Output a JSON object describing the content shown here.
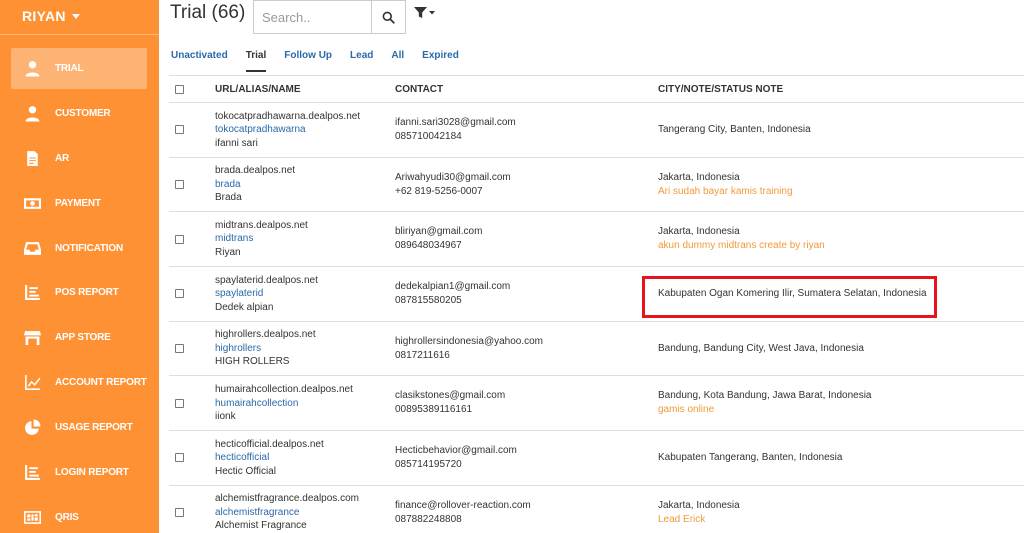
{
  "sidebar": {
    "username": "RIYAN",
    "items": [
      {
        "label": "TRIAL",
        "icon": "user-icon",
        "active": true
      },
      {
        "label": "CUSTOMER",
        "icon": "user-icon",
        "active": false
      },
      {
        "label": "AR",
        "icon": "document-icon",
        "active": false
      },
      {
        "label": "PAYMENT",
        "icon": "money-icon",
        "active": false
      },
      {
        "label": "NOTIFICATION",
        "icon": "inbox-icon",
        "active": false
      },
      {
        "label": "POS REPORT",
        "icon": "list-chart-icon",
        "active": false
      },
      {
        "label": "APP STORE",
        "icon": "store-icon",
        "active": false
      },
      {
        "label": "ACCOUNT REPORT",
        "icon": "line-chart-icon",
        "active": false
      },
      {
        "label": "USAGE REPORT",
        "icon": "pie-chart-icon",
        "active": false
      },
      {
        "label": "LOGIN REPORT",
        "icon": "list-chart-icon",
        "active": false
      },
      {
        "label": "QRIS",
        "icon": "qris-icon",
        "active": false
      }
    ]
  },
  "header": {
    "title": "Trial (66)",
    "search_placeholder": "Search.."
  },
  "tabs": [
    {
      "label": "Unactivated",
      "active": false
    },
    {
      "label": "Trial",
      "active": true
    },
    {
      "label": "Follow Up",
      "active": false
    },
    {
      "label": "Lead",
      "active": false
    },
    {
      "label": "All",
      "active": false
    },
    {
      "label": "Expired",
      "active": false
    }
  ],
  "table": {
    "columns": [
      "URL/ALIAS/NAME",
      "CONTACT",
      "CITY/NOTE/STATUS NOTE"
    ],
    "rows": [
      {
        "url": "tokocatpradhawarna.dealpos.net",
        "alias": "tokocatpradhawarna",
        "name": "ifanni sari",
        "email": "ifanni.sari3028@gmail.com",
        "phone": "085710042184",
        "city": "Tangerang City, Banten, Indonesia",
        "note": ""
      },
      {
        "url": "brada.dealpos.net",
        "alias": "brada",
        "name": "Brada",
        "email": "Ariwahyudi30@gmail.com",
        "phone": "+62 819-5256-0007",
        "city": "Jakarta, Indonesia",
        "note": "Ari sudah bayar kamis training"
      },
      {
        "url": "midtrans.dealpos.net",
        "alias": "midtrans",
        "name": "Riyan",
        "email": "bliriyan@gmail.com",
        "phone": "089648034967",
        "city": "Jakarta, Indonesia",
        "note": "akun dummy midtrans create by riyan"
      },
      {
        "url": "spaylaterid.dealpos.net",
        "alias": "spaylaterid",
        "name": "Dedek alpian",
        "email": "dedekalpian1@gmail.com",
        "phone": "087815580205",
        "city": "Kabupaten Ogan Komering Ilir, Sumatera Selatan, Indonesia",
        "note": "",
        "highlighted": true
      },
      {
        "url": "highrollers.dealpos.net",
        "alias": "highrollers",
        "name": "HIGH ROLLERS",
        "email": "highrollersindonesia@yahoo.com",
        "phone": "0817211616",
        "city": "Bandung, Bandung City, West Java, Indonesia",
        "note": ""
      },
      {
        "url": "humairahcollection.dealpos.net",
        "alias": "humairahcollection",
        "name": "iionk",
        "email": "clasikstones@gmail.com",
        "phone": "00895389116161",
        "city": "Bandung, Kota Bandung, Jawa Barat, Indonesia",
        "note": "gamis online"
      },
      {
        "url": "hecticofficial.dealpos.net",
        "alias": "hecticofficial",
        "name": "Hectic Official",
        "email": "Hecticbehavior@gmail.com",
        "phone": "085714195720",
        "city": "Kabupaten Tangerang, Banten, Indonesia",
        "note": ""
      },
      {
        "url": "alchemistfragrance.dealpos.com",
        "alias": "alchemistfragrance",
        "name": "Alchemist Fragrance",
        "email": "finance@rollover-reaction.com",
        "phone": "087882248808",
        "city": "Jakarta, Indonesia",
        "note": "Lead Erick"
      }
    ]
  },
  "colors": {
    "sidebar_bg": "#fd9133",
    "active_item_bg": "#fdb373",
    "link_blue": "#2a6aa8",
    "note_orange": "#f29a3a",
    "highlight_red": "#e8121a"
  }
}
